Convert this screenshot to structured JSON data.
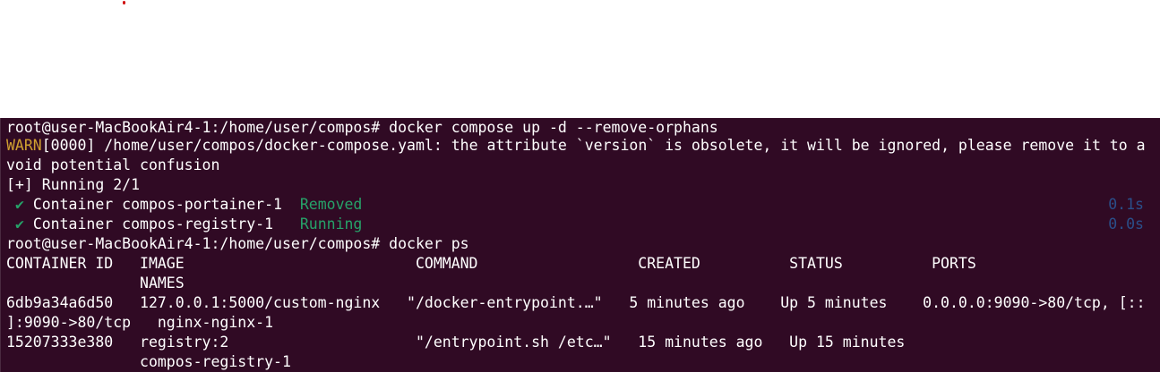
{
  "terminal": {
    "line1": "root@user-MacBookAir4-1:/home/user/compos# docker compose up -d --remove-orphans",
    "warn_tag": "WARN",
    "warn_rest": "[0000] /home/user/compos/docker-compose.yaml: the attribute `version` is obsolete, it will be ignored, please remove it to a",
    "warn_cont": "void potential confusion",
    "running": "[+] Running 2/1",
    "checkmark": "✔",
    "c1_label": "Container compos-portainer-1  ",
    "c1_status": "Removed",
    "c1_time": "0.1s",
    "c2_label": "Container compos-registry-1   ",
    "c2_status": "Running",
    "c2_time": "0.0s",
    "line_ps": "root@user-MacBookAir4-1:/home/user/compos# docker ps",
    "header": "CONTAINER ID   IMAGE                          COMMAND                  CREATED          STATUS          PORTS",
    "header_names": "               NAMES",
    "row1_a": "6db9a34a6d50   127.0.0.1:5000/custom-nginx   \"/docker-entrypoint.…\"   5 minutes ago    Up 5 minutes    0.0.0.0:9090->80/tcp, [::",
    "row1_b": "]:9090->80/tcp   nginx-nginx-1",
    "row2_a": "15207333e380   registry:2                     \"/entrypoint.sh /etc…\"   15 minutes ago   Up 15 minutes",
    "row2_b": "               compos-registry-1"
  }
}
